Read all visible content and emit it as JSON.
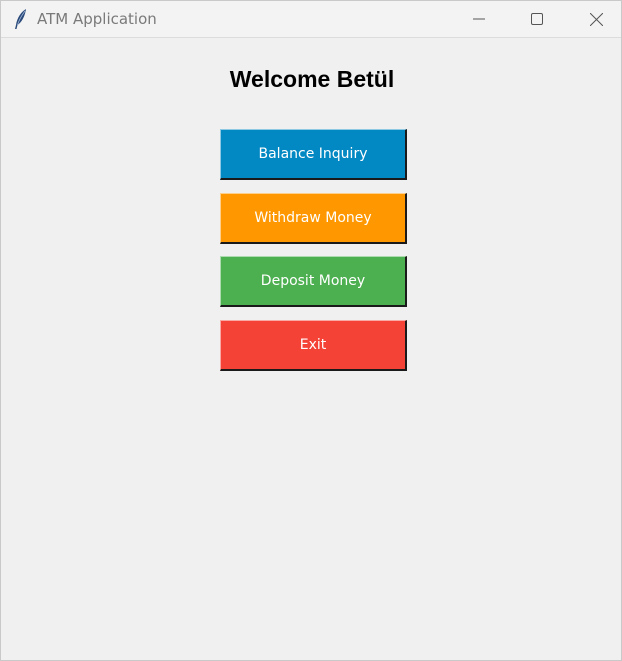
{
  "window": {
    "title": "ATM Application",
    "controls": {
      "minimize_icon": "minimize-icon",
      "maximize_icon": "maximize-icon",
      "close_icon": "close-icon"
    }
  },
  "main": {
    "welcome": "Welcome Betül",
    "buttons": [
      {
        "label": "Balance Inquiry",
        "color": "#0288c2"
      },
      {
        "label": "Withdraw Money",
        "color": "#ff9800"
      },
      {
        "label": "Deposit Money",
        "color": "#4caf50"
      },
      {
        "label": "Exit",
        "color": "#f44236"
      }
    ]
  },
  "colors": {
    "window_bg": "#f0f0f0",
    "titlebar_bg": "#f3f3f3",
    "app_icon": "feather-icon"
  }
}
